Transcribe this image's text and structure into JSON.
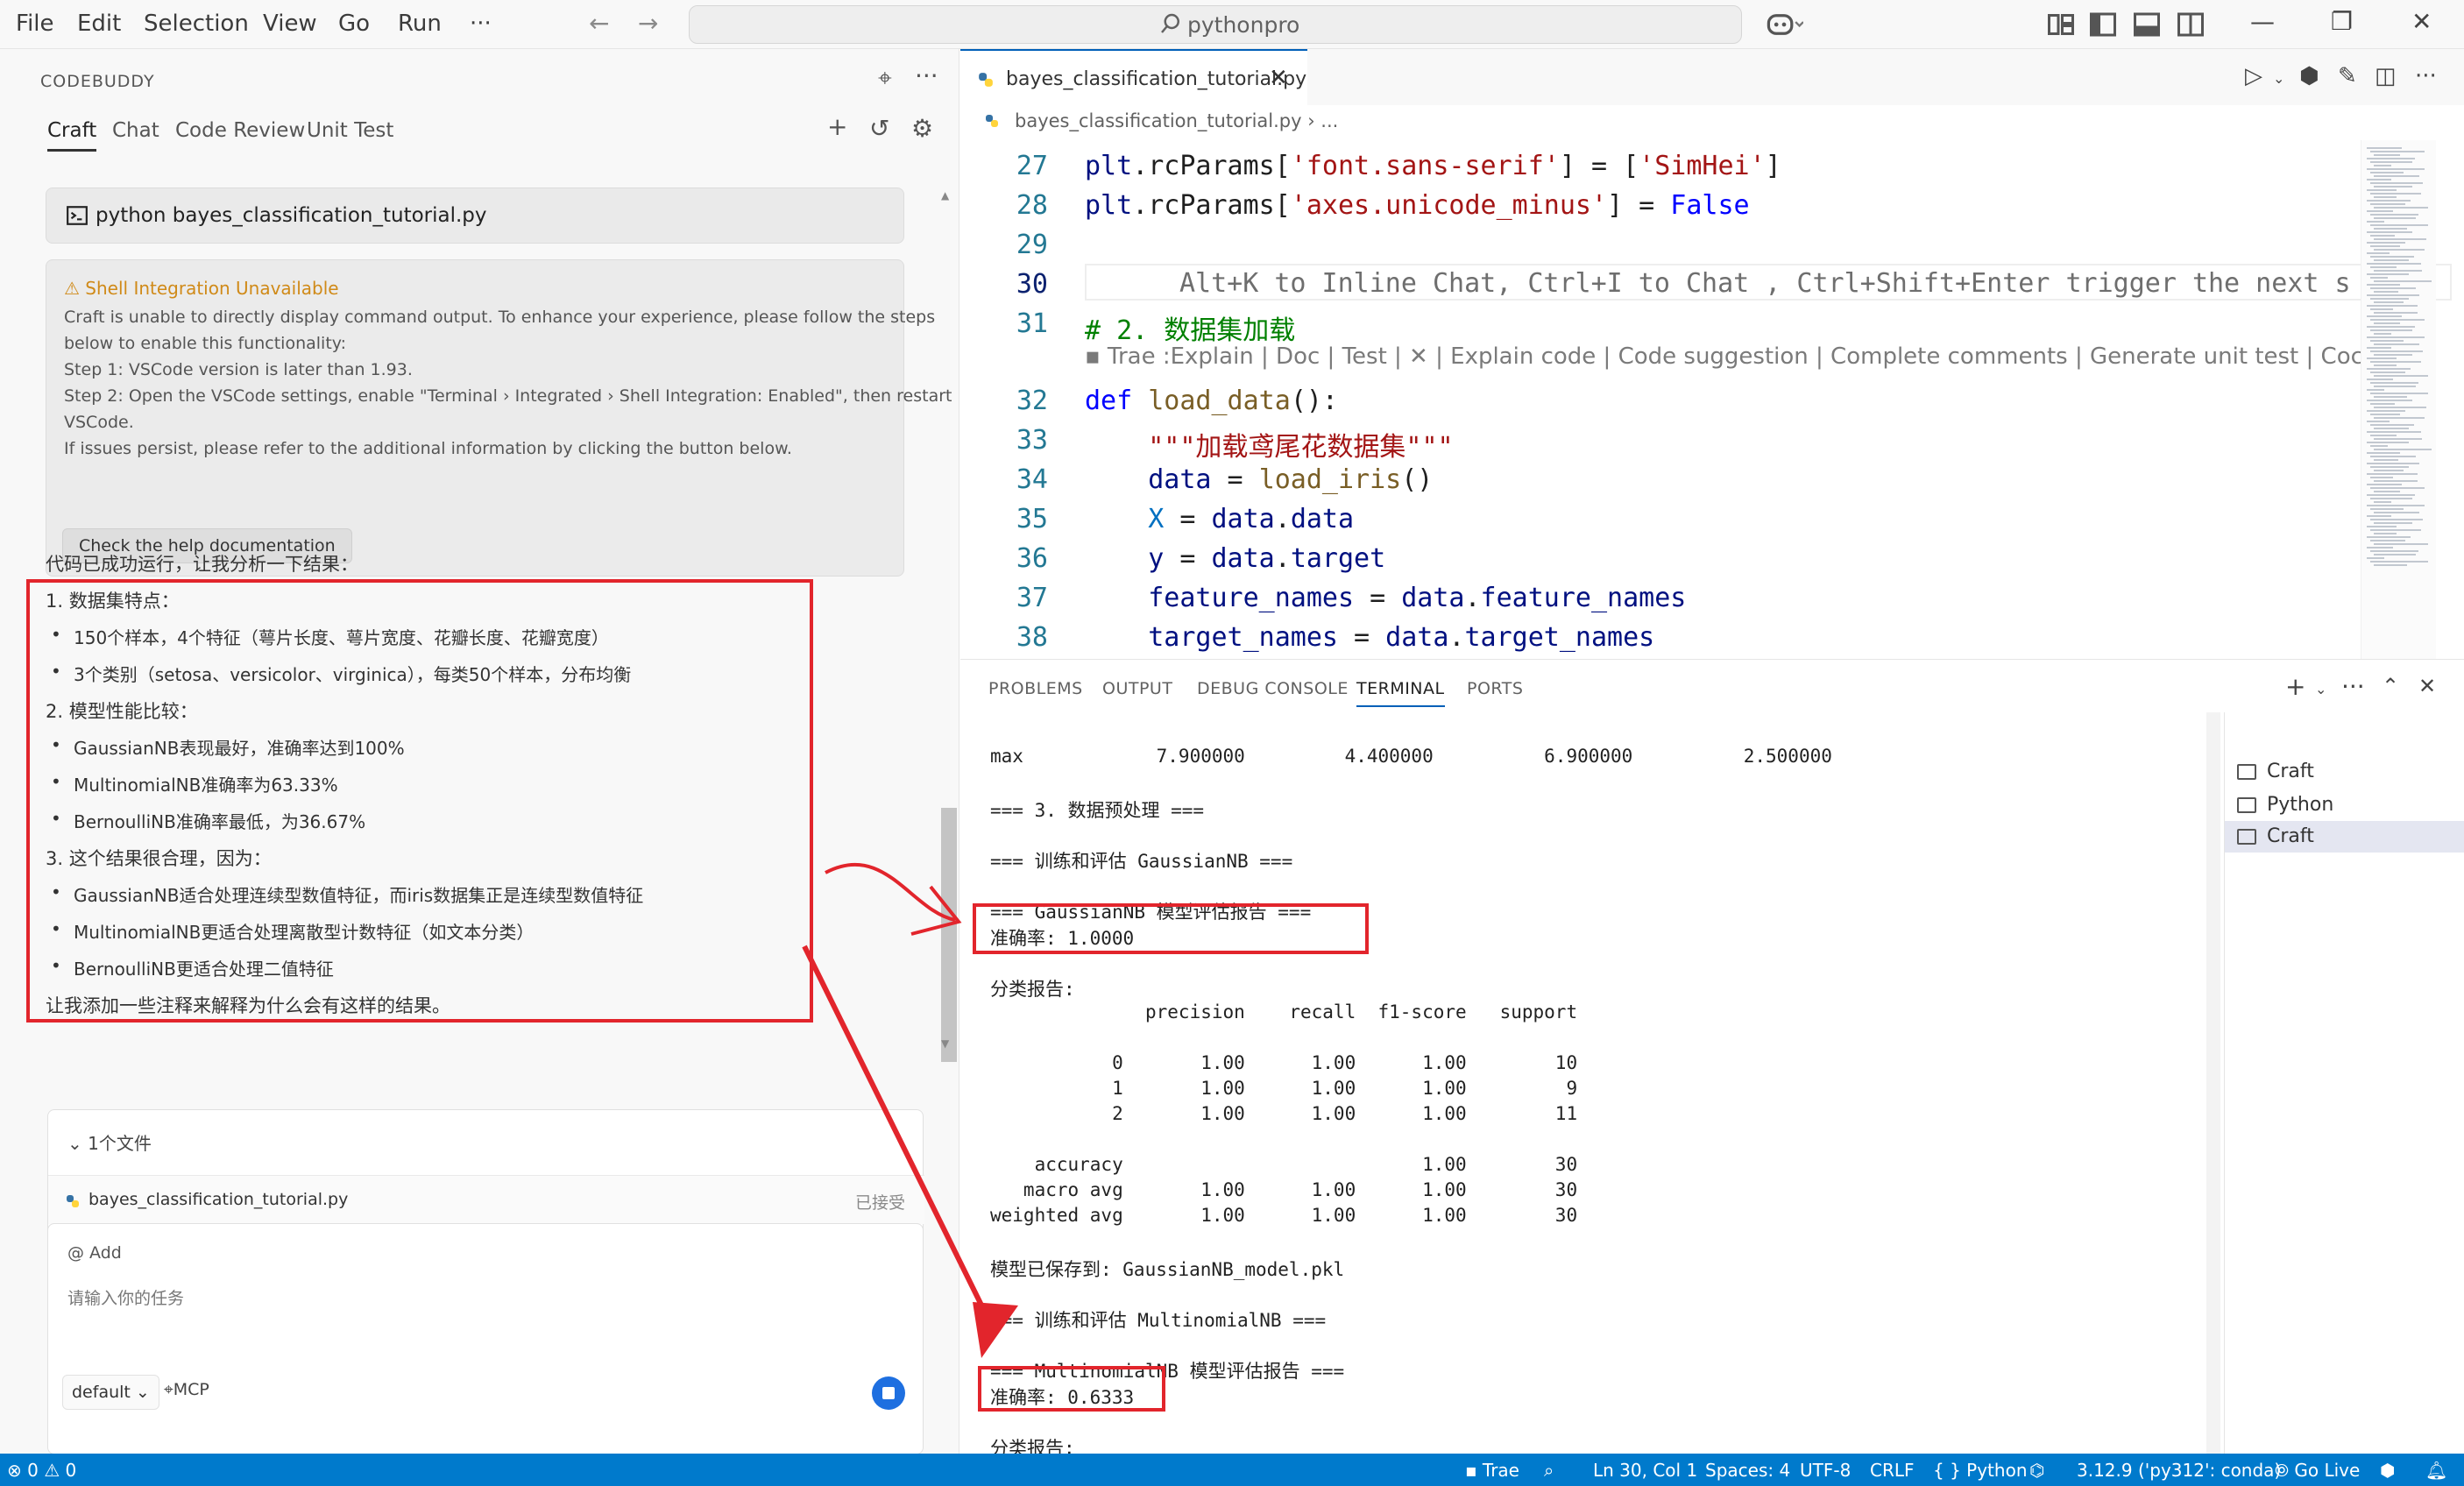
{
  "titlebar": {
    "menu": [
      "File",
      "Edit",
      "Selection",
      "View",
      "Go",
      "Run",
      "···"
    ],
    "search_label": "pythonpro"
  },
  "codebuddy": {
    "panel_title": "CODEBUDDY",
    "tabs": [
      "Craft",
      "Chat",
      "Code Review",
      "Unit Test"
    ],
    "command": "python bayes_classification_tutorial.py",
    "warning": {
      "title": "Shell Integration Unavailable",
      "lines": [
        "Craft is unable to directly display command output. To enhance your experience, please follow the steps",
        "below to enable this functionality:",
        "Step 1: VSCode version is later than 1.93.",
        "Step 2: Open the VSCode settings, enable \"Terminal › Integrated › Shell Integration: Enabled\", then restart",
        "VSCode.",
        "If issues persist, please refer to the additional information by clicking the button below."
      ],
      "button": "Check the help documentation"
    },
    "answer": {
      "intro": "代码已成功运行，让我分析一下结果：",
      "h1": "1. 数据集特点：",
      "b1": [
        "150个样本，4个特征（萼片长度、萼片宽度、花瓣长度、花瓣宽度）",
        "3个类别（setosa、versicolor、virginica），每类50个样本，分布均衡"
      ],
      "h2": "2. 模型性能比较：",
      "b2": [
        "GaussianNB表现最好，准确率达到100%",
        "MultinomialNB准确率为63.33%",
        "BernoulliNB准确率最低，为36.67%"
      ],
      "h3": "3. 这个结果很合理，因为：",
      "b3": [
        "GaussianNB适合处理连续型数值特征，而iris数据集正是连续型数值特征",
        "MultinomialNB更适合处理离散型计数特征（如文本分类）",
        "BernoulliNB更适合处理二值特征"
      ],
      "outro": "让我添加一些注释来解释为什么会有这样的结果。"
    },
    "files": {
      "header": "1个文件",
      "file": "bayes_classification_tutorial.py",
      "status": "已接受"
    },
    "input": {
      "add": "@ Add",
      "placeholder": "请输入你的任务",
      "mode": "default",
      "mcp": "MCP"
    }
  },
  "editor": {
    "tab": "bayes_classification_tutorial.py",
    "breadcrumb": "bayes_classification_tutorial.py  ›  ...",
    "inline_hint": "Alt+K to Inline Chat, Ctrl+I to Chat , Ctrl+Shift+Enter trigger the next s",
    "codelens": "Trae :Explain | Doc | Test | ✕ | Explain code | Code suggestion | Complete comments | Generate unit test | Coc",
    "lines": {
      "27": "27",
      "28": "28",
      "29": "29",
      "30": "30",
      "31": "31",
      "32": "32",
      "33": "33",
      "34": "34",
      "35": "35",
      "36": "36",
      "37": "37",
      "38": "38"
    },
    "code": {
      "l27a": "plt",
      "l27b": ".rcParams[",
      "l27c": "'font.sans-serif'",
      "l27d": "] = [",
      "l27e": "'SimHei'",
      "l27f": "]",
      "l28a": "plt",
      "l28b": ".rcParams[",
      "l28c": "'axes.unicode_minus'",
      "l28d": "] = ",
      "l28e": "False",
      "l31": "# 2. 数据集加载",
      "l32a": "def ",
      "l32b": "load_data",
      "l32c": "():",
      "l33": "    \"\"\"加载鸢尾花数据集\"\"\"",
      "l34a": "    data",
      "l34b": " = ",
      "l34c": "load_iris",
      "l34d": "()",
      "l35a": "    X",
      "l35b": " = ",
      "l35c": "data",
      "l35d": ".",
      "l35e": "data",
      "l36a": "    y",
      "l36b": " = ",
      "l36c": "data",
      "l36d": ".",
      "l36e": "target",
      "l37a": "    feature_names",
      "l37b": " = ",
      "l37c": "data",
      "l37d": ".",
      "l37e": "feature_names",
      "l38a": "    target_names",
      "l38b": " = ",
      "l38c": "data",
      "l38d": ".",
      "l38e": "target_names"
    }
  },
  "panel": {
    "tabs": [
      "PROBLEMS",
      "OUTPUT",
      "DEBUG CONSOLE",
      "TERMINAL",
      "PORTS"
    ],
    "terminal_lines": [
      "max            7.900000         4.400000          6.900000          2.500000",
      "=== 3. 数据预处理 ===",
      "=== 训练和评估 GaussianNB ===",
      "=== GaussianNB 模型评估报告 ===",
      "准确率: 1.0000",
      "分类报告:",
      "              precision    recall  f1-score   support",
      "           0       1.00      1.00      1.00        10",
      "           1       1.00      1.00      1.00         9",
      "           2       1.00      1.00      1.00        11",
      "    accuracy                           1.00        30",
      "   macro avg       1.00      1.00      1.00        30",
      "weighted avg       1.00      1.00      1.00        30",
      "模型已保存到: GaussianNB_model.pkl",
      "=== 训练和评估 MultinomialNB ===",
      "=== MultinomialNB 模型评估报告 ===",
      "准确率: 0.6333",
      "分类报告:"
    ],
    "terminals": [
      "Craft",
      "Python",
      "Craft"
    ]
  },
  "statusbar": {
    "problems": "⊗ 0 ⚠ 0",
    "trae": "Trae",
    "position": "Ln 30, Col 1",
    "spaces": "Spaces: 4",
    "encoding": "UTF-8",
    "eol": "CRLF",
    "language": "{ } Python",
    "interpreter": "3.12.9 ('py312': conda)",
    "golive": "Go Live"
  },
  "colors": {
    "accent": "#007acc",
    "highlight_red": "#e2252c",
    "warning": "#d08a18"
  }
}
